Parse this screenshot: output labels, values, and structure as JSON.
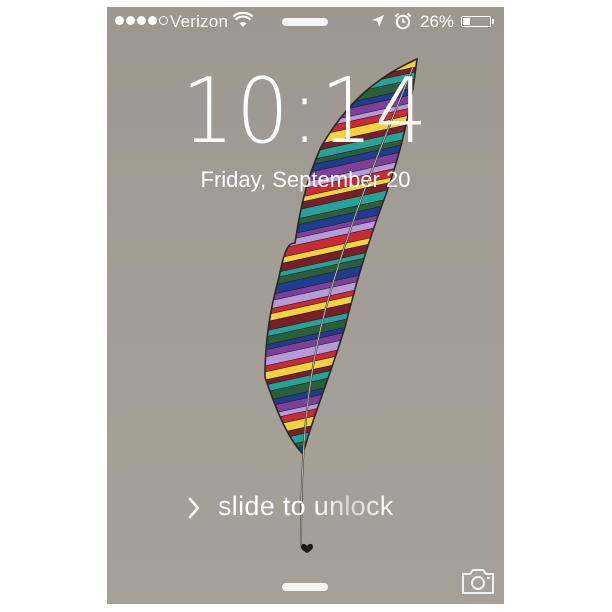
{
  "status_bar": {
    "signal_bars_filled": 4,
    "signal_bars_total": 5,
    "carrier": "Verizon",
    "wifi_icon": "wifi-icon",
    "location_icon": "location-arrow-icon",
    "alarm_icon": "alarm-clock-icon",
    "battery_percent_label": "26%",
    "battery_level": 0.26
  },
  "lock_screen": {
    "time": "10:14",
    "date": "Friday, September 20",
    "slide_label": "slide to unlock",
    "chevron_icon": "chevron-right-icon",
    "camera_icon": "camera-icon",
    "wallpaper": "rainbow-feather-illustration"
  },
  "colors": {
    "background": "#a09c93",
    "text": "#ffffff",
    "feather_stripes": [
      "#1f3d8c",
      "#c92a36",
      "#24a39a",
      "#7c3f9a",
      "#f2d33c",
      "#2b5f3b",
      "#b79ad8",
      "#7a1e2a"
    ]
  }
}
